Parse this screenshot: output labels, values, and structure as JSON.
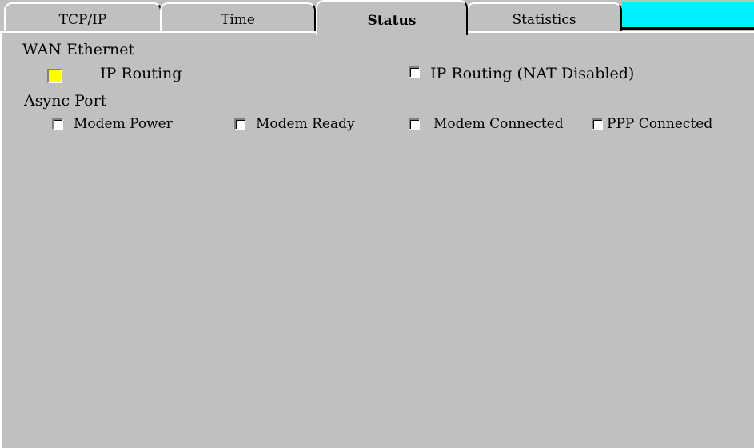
{
  "tabs": [
    {
      "label": "TCP/IP"
    },
    {
      "label": "Time"
    },
    {
      "label": "Status",
      "active": true
    },
    {
      "label": "Statistics"
    }
  ],
  "accent_color": "#00f0ff",
  "wan_section": {
    "title": "WAN Ethernet",
    "items": [
      {
        "label": "IP Routing",
        "checked": true,
        "indicator_color": "#ffff00"
      },
      {
        "label": "IP Routing (NAT Disabled)",
        "checked": false
      }
    ]
  },
  "async_section": {
    "title": "Async Port",
    "items": [
      {
        "label": "Modem Power",
        "checked": false
      },
      {
        "label": "Modem Ready",
        "checked": false
      },
      {
        "label": "Modem Connected",
        "checked": false
      },
      {
        "label": "PPP Connected",
        "checked": false
      }
    ]
  }
}
